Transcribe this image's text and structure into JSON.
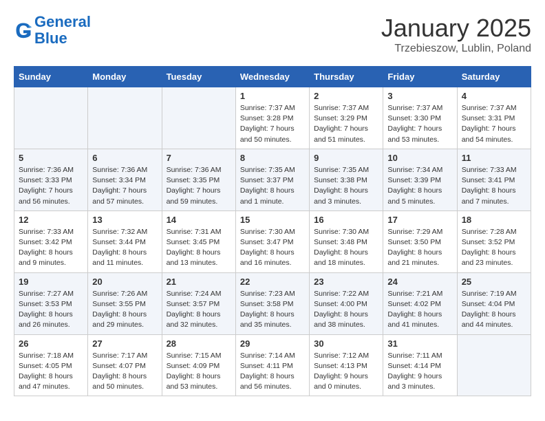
{
  "logo": {
    "line1": "General",
    "line2": "Blue"
  },
  "calendar": {
    "title": "January 2025",
    "subtitle": "Trzebieszow, Lublin, Poland"
  },
  "headers": [
    "Sunday",
    "Monday",
    "Tuesday",
    "Wednesday",
    "Thursday",
    "Friday",
    "Saturday"
  ],
  "weeks": [
    [
      {
        "day": "",
        "info": ""
      },
      {
        "day": "",
        "info": ""
      },
      {
        "day": "",
        "info": ""
      },
      {
        "day": "1",
        "info": "Sunrise: 7:37 AM\nSunset: 3:28 PM\nDaylight: 7 hours\nand 50 minutes."
      },
      {
        "day": "2",
        "info": "Sunrise: 7:37 AM\nSunset: 3:29 PM\nDaylight: 7 hours\nand 51 minutes."
      },
      {
        "day": "3",
        "info": "Sunrise: 7:37 AM\nSunset: 3:30 PM\nDaylight: 7 hours\nand 53 minutes."
      },
      {
        "day": "4",
        "info": "Sunrise: 7:37 AM\nSunset: 3:31 PM\nDaylight: 7 hours\nand 54 minutes."
      }
    ],
    [
      {
        "day": "5",
        "info": "Sunrise: 7:36 AM\nSunset: 3:33 PM\nDaylight: 7 hours\nand 56 minutes."
      },
      {
        "day": "6",
        "info": "Sunrise: 7:36 AM\nSunset: 3:34 PM\nDaylight: 7 hours\nand 57 minutes."
      },
      {
        "day": "7",
        "info": "Sunrise: 7:36 AM\nSunset: 3:35 PM\nDaylight: 7 hours\nand 59 minutes."
      },
      {
        "day": "8",
        "info": "Sunrise: 7:35 AM\nSunset: 3:37 PM\nDaylight: 8 hours\nand 1 minute."
      },
      {
        "day": "9",
        "info": "Sunrise: 7:35 AM\nSunset: 3:38 PM\nDaylight: 8 hours\nand 3 minutes."
      },
      {
        "day": "10",
        "info": "Sunrise: 7:34 AM\nSunset: 3:39 PM\nDaylight: 8 hours\nand 5 minutes."
      },
      {
        "day": "11",
        "info": "Sunrise: 7:33 AM\nSunset: 3:41 PM\nDaylight: 8 hours\nand 7 minutes."
      }
    ],
    [
      {
        "day": "12",
        "info": "Sunrise: 7:33 AM\nSunset: 3:42 PM\nDaylight: 8 hours\nand 9 minutes."
      },
      {
        "day": "13",
        "info": "Sunrise: 7:32 AM\nSunset: 3:44 PM\nDaylight: 8 hours\nand 11 minutes."
      },
      {
        "day": "14",
        "info": "Sunrise: 7:31 AM\nSunset: 3:45 PM\nDaylight: 8 hours\nand 13 minutes."
      },
      {
        "day": "15",
        "info": "Sunrise: 7:30 AM\nSunset: 3:47 PM\nDaylight: 8 hours\nand 16 minutes."
      },
      {
        "day": "16",
        "info": "Sunrise: 7:30 AM\nSunset: 3:48 PM\nDaylight: 8 hours\nand 18 minutes."
      },
      {
        "day": "17",
        "info": "Sunrise: 7:29 AM\nSunset: 3:50 PM\nDaylight: 8 hours\nand 21 minutes."
      },
      {
        "day": "18",
        "info": "Sunrise: 7:28 AM\nSunset: 3:52 PM\nDaylight: 8 hours\nand 23 minutes."
      }
    ],
    [
      {
        "day": "19",
        "info": "Sunrise: 7:27 AM\nSunset: 3:53 PM\nDaylight: 8 hours\nand 26 minutes."
      },
      {
        "day": "20",
        "info": "Sunrise: 7:26 AM\nSunset: 3:55 PM\nDaylight: 8 hours\nand 29 minutes."
      },
      {
        "day": "21",
        "info": "Sunrise: 7:24 AM\nSunset: 3:57 PM\nDaylight: 8 hours\nand 32 minutes."
      },
      {
        "day": "22",
        "info": "Sunrise: 7:23 AM\nSunset: 3:58 PM\nDaylight: 8 hours\nand 35 minutes."
      },
      {
        "day": "23",
        "info": "Sunrise: 7:22 AM\nSunset: 4:00 PM\nDaylight: 8 hours\nand 38 minutes."
      },
      {
        "day": "24",
        "info": "Sunrise: 7:21 AM\nSunset: 4:02 PM\nDaylight: 8 hours\nand 41 minutes."
      },
      {
        "day": "25",
        "info": "Sunrise: 7:19 AM\nSunset: 4:04 PM\nDaylight: 8 hours\nand 44 minutes."
      }
    ],
    [
      {
        "day": "26",
        "info": "Sunrise: 7:18 AM\nSunset: 4:05 PM\nDaylight: 8 hours\nand 47 minutes."
      },
      {
        "day": "27",
        "info": "Sunrise: 7:17 AM\nSunset: 4:07 PM\nDaylight: 8 hours\nand 50 minutes."
      },
      {
        "day": "28",
        "info": "Sunrise: 7:15 AM\nSunset: 4:09 PM\nDaylight: 8 hours\nand 53 minutes."
      },
      {
        "day": "29",
        "info": "Sunrise: 7:14 AM\nSunset: 4:11 PM\nDaylight: 8 hours\nand 56 minutes."
      },
      {
        "day": "30",
        "info": "Sunrise: 7:12 AM\nSunset: 4:13 PM\nDaylight: 9 hours\nand 0 minutes."
      },
      {
        "day": "31",
        "info": "Sunrise: 7:11 AM\nSunset: 4:14 PM\nDaylight: 9 hours\nand 3 minutes."
      },
      {
        "day": "",
        "info": ""
      }
    ]
  ]
}
